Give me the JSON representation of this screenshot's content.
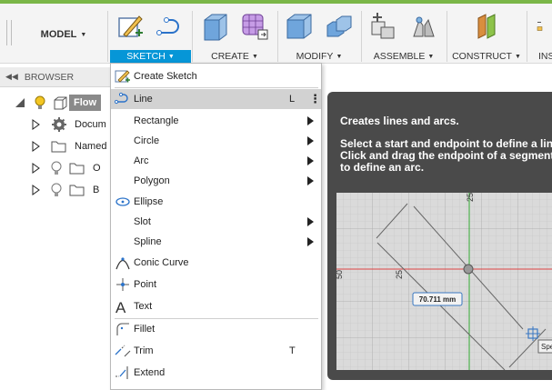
{
  "toolbar": {
    "model_label": "MODEL",
    "groups": [
      {
        "label": "SKETCH"
      },
      {
        "label": "CREATE"
      },
      {
        "label": "MODIFY"
      },
      {
        "label": "ASSEMBLE"
      },
      {
        "label": "CONSTRUCT"
      },
      {
        "label": "INS"
      }
    ],
    "colors": {
      "accent": "#7ab648",
      "active": "#0696d7"
    }
  },
  "browser": {
    "header": "BROWSER",
    "items": [
      {
        "label": "Flow"
      },
      {
        "label": "Docum"
      },
      {
        "label": "Named"
      },
      {
        "label": "O"
      },
      {
        "label": "B"
      }
    ]
  },
  "sketch_menu": {
    "items": [
      {
        "label": "Create Sketch",
        "icon": "create-sketch-icon"
      },
      {
        "label": "Line",
        "shortcut": "L",
        "icon": "line-icon",
        "highlighted": true
      },
      {
        "label": "Rectangle",
        "icon": "none"
      },
      {
        "label": "Circle",
        "icon": "none"
      },
      {
        "label": "Arc",
        "icon": "none"
      },
      {
        "label": "Polygon",
        "icon": "none"
      },
      {
        "label": "Ellipse",
        "icon": "ellipse-icon"
      },
      {
        "label": "Slot",
        "icon": "none"
      },
      {
        "label": "Spline",
        "icon": "none"
      },
      {
        "label": "Conic Curve",
        "icon": "conic-curve-icon"
      },
      {
        "label": "Point",
        "icon": "point-icon"
      },
      {
        "label": "Text",
        "icon": "text-icon"
      },
      {
        "label": "Fillet",
        "icon": "fillet-icon"
      },
      {
        "label": "Trim",
        "shortcut": "T",
        "icon": "trim-icon"
      },
      {
        "label": "Extend",
        "icon": "extend-icon"
      }
    ]
  },
  "tooltip": {
    "title": "Creates lines and arcs.",
    "description": "Select a start and endpoint to define a line. Click and drag the endpoint of a segment to define an arc.",
    "image": {
      "dimension_label": "70.711 mm",
      "axis_label_top": "25",
      "axis_label_mid": "25",
      "axis_label_left": "50",
      "badge_text": "Spe"
    }
  }
}
